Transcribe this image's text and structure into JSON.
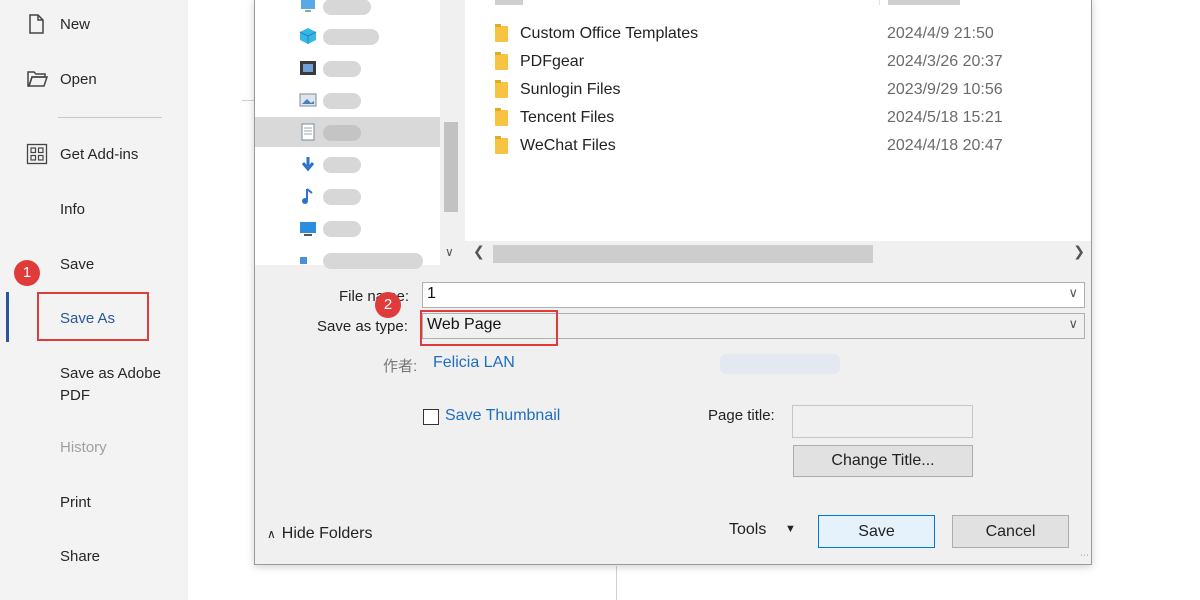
{
  "sidebar": {
    "items": [
      {
        "label": "New",
        "icon": "new-document-icon"
      },
      {
        "label": "Open",
        "icon": "open-folder-icon"
      },
      {
        "label": "Get Add-ins",
        "icon": "add-ins-icon"
      },
      {
        "label": "Info"
      },
      {
        "label": "Save"
      },
      {
        "label": "Save As",
        "selected": true
      },
      {
        "label": "Save as Adobe PDF"
      },
      {
        "label": "History",
        "disabled": true
      },
      {
        "label": "Print"
      },
      {
        "label": "Share"
      }
    ],
    "accent_color": "#2b579a"
  },
  "annotations": {
    "badge_1": "1",
    "badge_2": "2",
    "color": "#e03b3b"
  },
  "dialog": {
    "files": [
      {
        "name": "Custom Office Templates",
        "date": "2024/4/9 21:50"
      },
      {
        "name": "PDFgear",
        "date": "2024/3/26 20:37"
      },
      {
        "name": "Sunlogin Files",
        "date": "2023/9/29 10:56"
      },
      {
        "name": "Tencent Files",
        "date": "2024/5/18 15:21"
      },
      {
        "name": "WeChat Files",
        "date": "2024/4/18 20:47"
      }
    ],
    "file_name_label": "File name:",
    "file_name_value": "1",
    "save_type_label": "Save as type:",
    "save_type_value": "Web Page",
    "author_label": "作者:",
    "author_value": "Felicia LAN",
    "save_thumbnail_label": "Save Thumbnail",
    "page_title_label": "Page title:",
    "page_title_value": "",
    "change_title_button": "Change Title...",
    "hide_folders_label": "Hide Folders",
    "tools_label": "Tools",
    "save_button": "Save",
    "cancel_button": "Cancel"
  }
}
